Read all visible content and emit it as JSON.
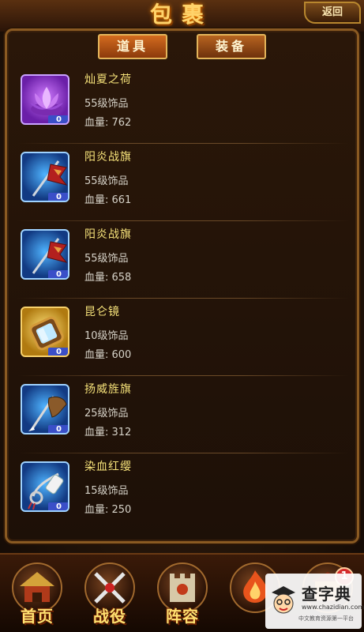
{
  "header": {
    "title": "包裹",
    "back_label": "返回"
  },
  "tabs": [
    {
      "label": "道具",
      "active": true
    },
    {
      "label": "装备",
      "active": false
    }
  ],
  "items": [
    {
      "name": "灿夏之荷",
      "level": "55级饰品",
      "hp": "血量: 762",
      "count": "0",
      "rarity": "purple",
      "icon": "lotus-icon"
    },
    {
      "name": "阳炎战旗",
      "level": "55级饰品",
      "hp": "血量: 661",
      "count": "0",
      "rarity": "blue",
      "icon": "war-banner-icon"
    },
    {
      "name": "阳炎战旗",
      "level": "55级饰品",
      "hp": "血量: 658",
      "count": "0",
      "rarity": "blue",
      "icon": "war-banner-icon"
    },
    {
      "name": "昆仑镜",
      "level": "10级饰品",
      "hp": "血量: 600",
      "count": "0",
      "rarity": "gold",
      "icon": "mirror-icon"
    },
    {
      "name": "扬威旌旗",
      "level": "25级饰品",
      "hp": "血量: 312",
      "count": "0",
      "rarity": "blue",
      "icon": "flag-icon"
    },
    {
      "name": "染血红缨",
      "level": "15级饰品",
      "hp": "血量: 250",
      "count": "0",
      "rarity": "blue",
      "icon": "tassel-icon"
    }
  ],
  "nav": [
    {
      "label": "首页",
      "icon": "palace-icon"
    },
    {
      "label": "战役",
      "icon": "crossed-swords-icon"
    },
    {
      "label": "阵容",
      "icon": "fortress-icon"
    },
    {
      "label": "",
      "icon": "fire-emblem-icon"
    },
    {
      "label": "",
      "icon": "shop-icon"
    }
  ],
  "notification_badge": "1",
  "watermark": {
    "title": "查字典",
    "url": "www.chazidian.com",
    "sub": "中文教育资源第一平台"
  },
  "colors": {
    "item_name": "#f6e27a",
    "tab_active": "#d36b1f",
    "frame": "#8a5a22"
  }
}
